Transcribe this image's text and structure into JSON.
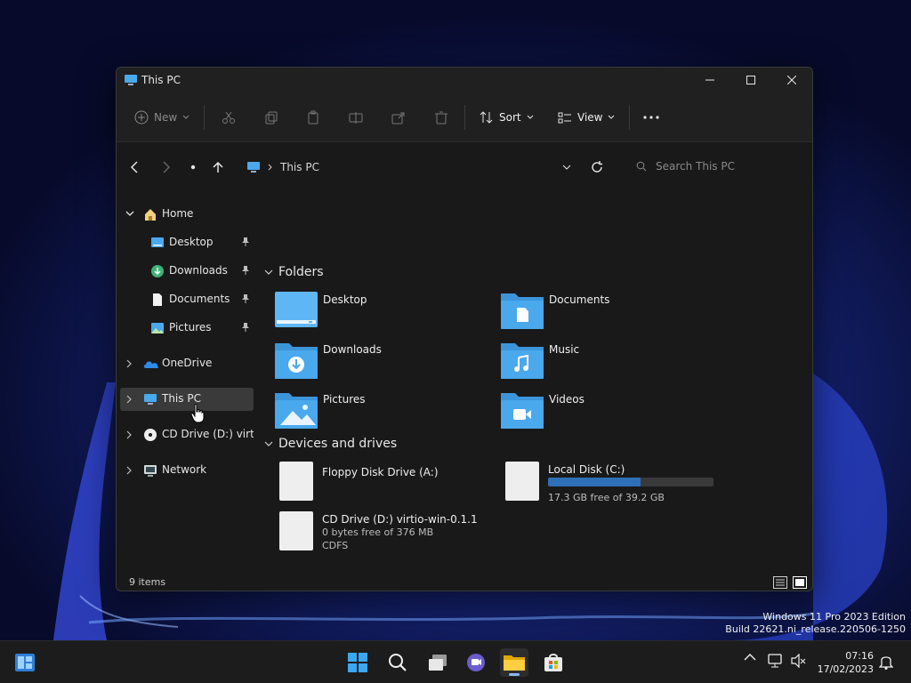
{
  "window": {
    "title": "This PC",
    "controls": {
      "minimize": "minimize",
      "maximize": "maximize",
      "close": "close"
    }
  },
  "toolbar": {
    "new_label": "New",
    "sort_label": "Sort",
    "view_label": "View",
    "items": [
      "cut-icon",
      "copy-icon",
      "paste-icon",
      "rename-icon",
      "share-icon",
      "delete-icon"
    ]
  },
  "address": {
    "crumb": "This PC",
    "search_placeholder": "Search This PC"
  },
  "sidebar": {
    "items": [
      {
        "label": "Home"
      },
      {
        "label": "Desktop"
      },
      {
        "label": "Downloads"
      },
      {
        "label": "Documents"
      },
      {
        "label": "Pictures"
      },
      {
        "label": "OneDrive"
      },
      {
        "label": "This PC"
      },
      {
        "label": "CD Drive (D:) virtio-w"
      },
      {
        "label": "Network"
      }
    ]
  },
  "content": {
    "folders_heading": "Folders",
    "folders": [
      {
        "name": "Desktop"
      },
      {
        "name": "Documents"
      },
      {
        "name": "Downloads"
      },
      {
        "name": "Music"
      },
      {
        "name": "Pictures"
      },
      {
        "name": "Videos"
      }
    ],
    "drives_heading": "Devices and drives",
    "drives": [
      {
        "name": "Floppy Disk Drive (A:)"
      },
      {
        "name": "Local Disk (C:)",
        "free": "17.3 GB free of 39.2 GB",
        "used_fraction": 0.56
      },
      {
        "name": "CD Drive (D:) virtio-win-0.1.1",
        "free": "0 bytes free of 376 MB",
        "fs": "CDFS"
      }
    ]
  },
  "status": {
    "count": "9 items"
  },
  "watermark": {
    "line1": "Windows 11 Pro 2023 Edition",
    "line2": "Build 22621.ni_release.220506-1250"
  },
  "clock": {
    "time": "07:16",
    "date": "17/02/2023"
  },
  "colors": {
    "accent": "#4cc2ff",
    "folder": "#4aa8ec",
    "drive_bar": "#2e6fb8"
  }
}
